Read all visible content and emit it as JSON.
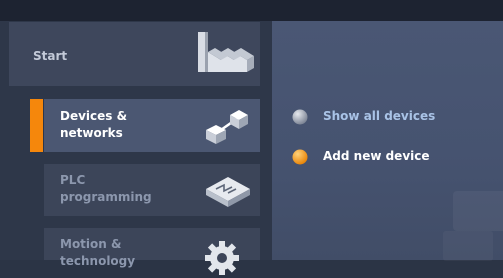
{
  "start": {
    "label": "Start",
    "icon": "factory-icon"
  },
  "nav": [
    {
      "label_line1": "Devices &",
      "label_line2": "networks",
      "icon": "network-nodes-icon",
      "active": true
    },
    {
      "label_line1": "PLC",
      "label_line2": "programming",
      "icon": "plc-block-icon",
      "active": false
    },
    {
      "label_line1": "Motion &",
      "label_line2": "technology",
      "icon": "gear-icon",
      "active": false
    }
  ],
  "actions": [
    {
      "label": "Show all devices",
      "icon": "gray-bullet-icon",
      "color": "#a3aab8"
    },
    {
      "label": "Add new device",
      "icon": "orange-bullet-icon",
      "color": "#f5960f"
    }
  ],
  "colors": {
    "accent": "#f5870c",
    "background": "#2b3445",
    "link_text": "#a9c3e6",
    "active_text": "#ffffff",
    "inactive_text": "#8c97ad"
  }
}
